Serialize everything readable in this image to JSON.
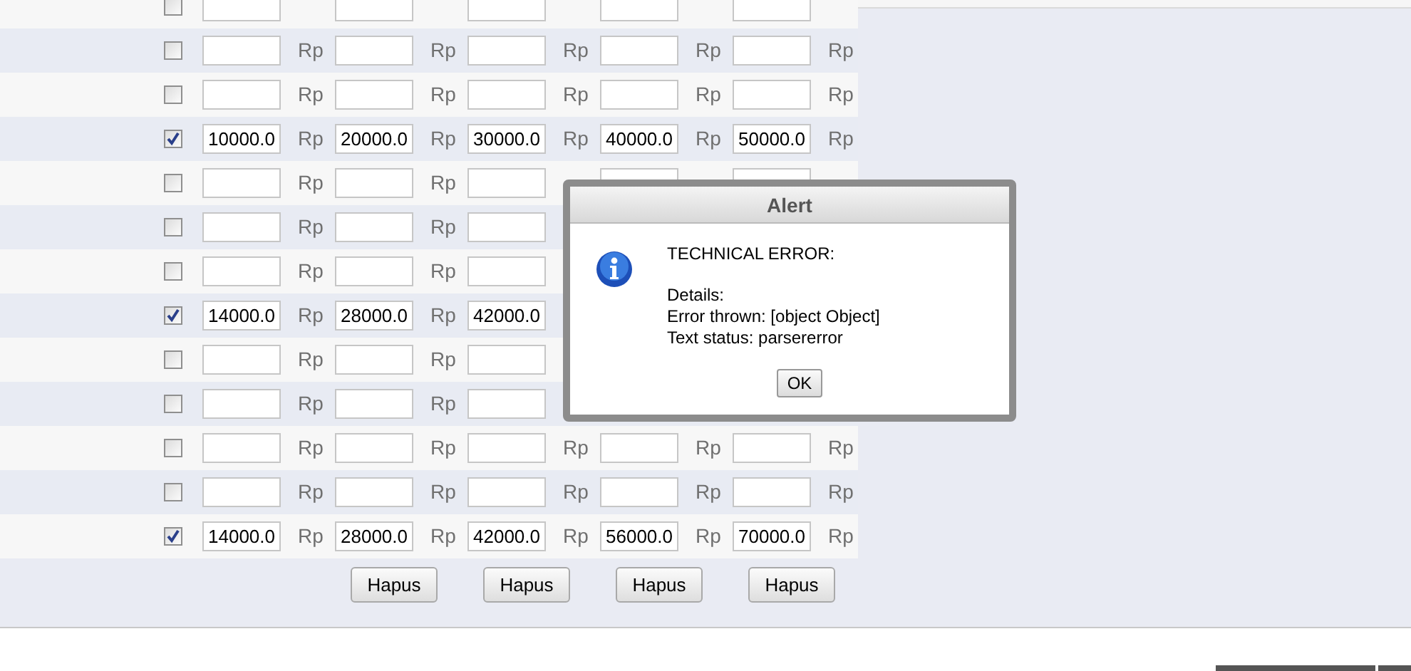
{
  "rows": [
    {
      "checked": false,
      "cells": [
        {},
        {},
        {},
        {},
        {}
      ]
    },
    {
      "checked": false,
      "cells": [
        {
          "unit": "Rp"
        },
        {
          "unit": "Rp"
        },
        {
          "unit": "Rp"
        },
        {
          "unit": "Rp"
        },
        {
          "unit": "Rp"
        }
      ]
    },
    {
      "checked": false,
      "cells": [
        {
          "unit": "Rp"
        },
        {
          "unit": "Rp"
        },
        {
          "unit": "Rp"
        },
        {
          "unit": "Rp"
        },
        {
          "unit": "Rp"
        }
      ]
    },
    {
      "checked": true,
      "cells": [
        {
          "value": "10000.0",
          "unit": "Rp"
        },
        {
          "value": "20000.0",
          "unit": "Rp"
        },
        {
          "value": "30000.0",
          "unit": "Rp"
        },
        {
          "value": "40000.0",
          "unit": "Rp"
        },
        {
          "value": "50000.0",
          "unit": "Rp"
        }
      ]
    },
    {
      "checked": false,
      "cells": [
        {
          "unit": "Rp"
        },
        {
          "unit": "Rp"
        },
        {},
        {},
        {}
      ]
    },
    {
      "checked": false,
      "cells": [
        {
          "unit": "Rp"
        },
        {
          "unit": "Rp"
        },
        {}
      ]
    },
    {
      "checked": false,
      "cells": [
        {
          "unit": "Rp"
        },
        {
          "unit": "Rp"
        },
        {}
      ]
    },
    {
      "checked": true,
      "cells": [
        {
          "value": "14000.0",
          "unit": "Rp"
        },
        {
          "value": "28000.0",
          "unit": "Rp"
        },
        {
          "value": "42000.0"
        }
      ]
    },
    {
      "checked": false,
      "cells": [
        {
          "unit": "Rp"
        },
        {
          "unit": "Rp"
        },
        {}
      ]
    },
    {
      "checked": false,
      "cells": [
        {
          "unit": "Rp"
        },
        {
          "unit": "Rp"
        },
        {}
      ]
    },
    {
      "checked": false,
      "cells": [
        {
          "unit": "Rp"
        },
        {
          "unit": "Rp"
        },
        {
          "unit": "Rp"
        },
        {
          "unit": "Rp"
        },
        {
          "unit": "Rp"
        }
      ]
    },
    {
      "checked": false,
      "cells": [
        {
          "unit": "Rp"
        },
        {
          "unit": "Rp"
        },
        {
          "unit": "Rp"
        },
        {
          "unit": "Rp"
        },
        {
          "unit": "Rp"
        }
      ]
    },
    {
      "checked": true,
      "cells": [
        {
          "value": "14000.0",
          "unit": "Rp"
        },
        {
          "value": "28000.0",
          "unit": "Rp"
        },
        {
          "value": "42000.0",
          "unit": "Rp"
        },
        {
          "value": "56000.0",
          "unit": "Rp"
        },
        {
          "value": "70000.0",
          "unit": "Rp"
        }
      ]
    }
  ],
  "buttons": [
    "Hapus",
    "Hapus",
    "Hapus",
    "Hapus"
  ],
  "dialog": {
    "title": "Alert",
    "message": [
      "TECHNICAL ERROR:",
      "Details:",
      "Error thrown: [object Object]",
      "Text status: parsererror"
    ],
    "button": "OK"
  }
}
